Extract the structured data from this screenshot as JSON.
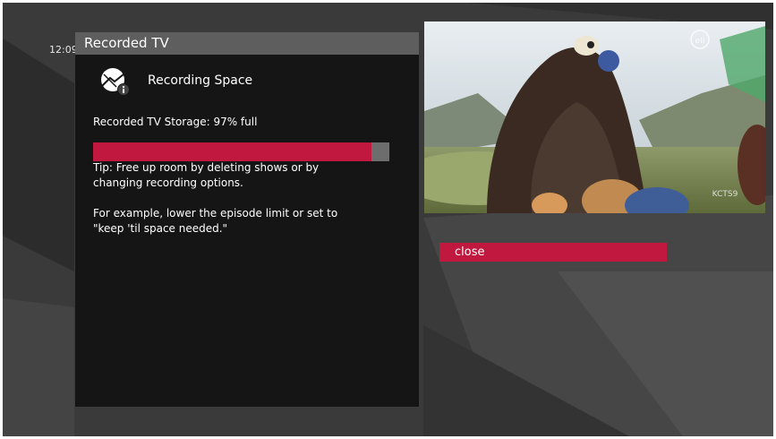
{
  "clock": {
    "time": "12:09"
  },
  "panel": {
    "title": "Recorded TV",
    "heading": "Recording Space",
    "icon": "recording-space-info-icon",
    "storage_text": "Recorded TV Storage: 97% full",
    "storage_fraction": 0.94,
    "tip": "Tip: Free up room by deleting shows or by changing recording options.",
    "example": "For example, lower the episode limit or set to \"keep 'til space needed.\""
  },
  "preview": {
    "channel_watermark": "KCTS9",
    "network_logo": "pbs-kids-logo"
  },
  "actions": {
    "close_label": "close"
  },
  "colors": {
    "accent": "#c0183f",
    "panel_bg": "#151515",
    "header_bg": "#5e5e5e",
    "progress_track": "#6d6d6d",
    "screen_bg": "#3a3a3a"
  }
}
